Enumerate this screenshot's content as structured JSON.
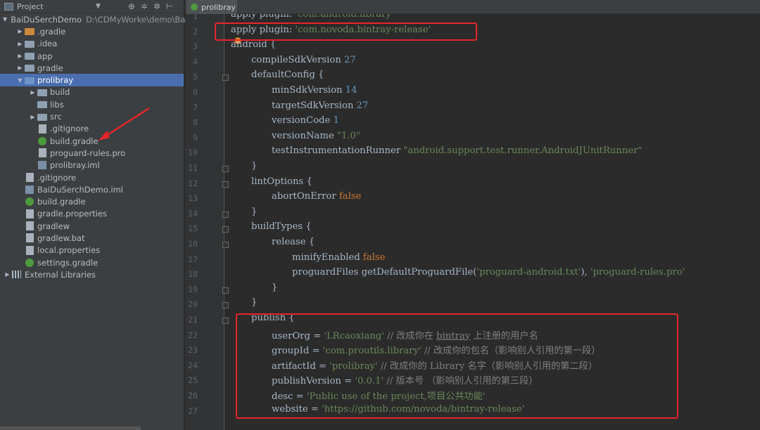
{
  "project_panel": {
    "title": "Project",
    "view_selector_icon": "chevron-down-icon",
    "tools": [
      "sync-icon",
      "collapse-icon",
      "gear-icon",
      "hide-icon"
    ],
    "tree": [
      {
        "label": "BaiDuSerchDemo",
        "path": "D:\\CDMyWorke\\demo\\Bai",
        "indent": 0,
        "arrow": "▼",
        "icon": "module",
        "selected": false
      },
      {
        "label": ".gradle",
        "indent": 1,
        "arrow": "▶",
        "icon": "folder-orange",
        "selected": false
      },
      {
        "label": ".idea",
        "indent": 1,
        "arrow": "▶",
        "icon": "folder",
        "selected": false
      },
      {
        "label": "app",
        "indent": 1,
        "arrow": "▶",
        "icon": "folder",
        "selected": false
      },
      {
        "label": "gradle",
        "indent": 1,
        "arrow": "▶",
        "icon": "folder",
        "selected": false
      },
      {
        "label": "prolibray",
        "indent": 1,
        "arrow": "▼",
        "icon": "folder-blue",
        "selected": true
      },
      {
        "label": "build",
        "indent": 2,
        "arrow": "▶",
        "icon": "folder",
        "selected": false
      },
      {
        "label": "libs",
        "indent": 2,
        "arrow": "",
        "icon": "folder",
        "selected": false
      },
      {
        "label": "src",
        "indent": 2,
        "arrow": "▶",
        "icon": "folder",
        "selected": false
      },
      {
        "label": ".gitignore",
        "indent": 2,
        "arrow": "",
        "icon": "file",
        "selected": false
      },
      {
        "label": "build.gradle",
        "indent": 2,
        "arrow": "",
        "icon": "gradle",
        "selected": false
      },
      {
        "label": "proguard-rules.pro",
        "indent": 2,
        "arrow": "",
        "icon": "file",
        "selected": false
      },
      {
        "label": "prolibray.iml",
        "indent": 2,
        "arrow": "",
        "icon": "iml",
        "selected": false
      },
      {
        "label": ".gitignore",
        "indent": 1,
        "arrow": "",
        "icon": "file",
        "selected": false
      },
      {
        "label": "BaiDuSerchDemo.iml",
        "indent": 1,
        "arrow": "",
        "icon": "iml",
        "selected": false
      },
      {
        "label": "build.gradle",
        "indent": 1,
        "arrow": "",
        "icon": "gradle",
        "selected": false
      },
      {
        "label": "gradle.properties",
        "indent": 1,
        "arrow": "",
        "icon": "file",
        "selected": false
      },
      {
        "label": "gradlew",
        "indent": 1,
        "arrow": "",
        "icon": "file",
        "selected": false
      },
      {
        "label": "gradlew.bat",
        "indent": 1,
        "arrow": "",
        "icon": "file",
        "selected": false
      },
      {
        "label": "local.properties",
        "indent": 1,
        "arrow": "",
        "icon": "file",
        "selected": false
      },
      {
        "label": "settings.gradle",
        "indent": 1,
        "arrow": "",
        "icon": "gradle",
        "selected": false
      },
      {
        "label": "External Libraries",
        "indent": 0,
        "arrow": "▶",
        "icon": "library",
        "selected": false
      }
    ]
  },
  "editor": {
    "tab_label": "prolibray",
    "tab_icon": "gradle-icon",
    "lines": [
      {
        "n": "1",
        "indent": 0,
        "tokens": [
          {
            "t": "apply plugin: ",
            "c": "plain"
          },
          {
            "t": "'com.android.library'",
            "c": "str"
          }
        ]
      },
      {
        "n": "2",
        "indent": 0,
        "tokens": [
          {
            "t": "apply plugin: ",
            "c": "plain"
          },
          {
            "t": "'com.novoda.bintray-release'",
            "c": "str"
          }
        ]
      },
      {
        "n": "3",
        "indent": 0,
        "tokens": [
          {
            "t": "android {",
            "c": "plain"
          }
        ]
      },
      {
        "n": "4",
        "indent": 1,
        "tokens": [
          {
            "t": "compileSdkVersion ",
            "c": "plain"
          },
          {
            "t": "27",
            "c": "num"
          }
        ]
      },
      {
        "n": "5",
        "indent": 1,
        "tokens": [
          {
            "t": "defaultConfig {",
            "c": "plain"
          }
        ]
      },
      {
        "n": "6",
        "indent": 2,
        "tokens": [
          {
            "t": "minSdkVersion ",
            "c": "plain"
          },
          {
            "t": "14",
            "c": "num"
          }
        ]
      },
      {
        "n": "7",
        "indent": 2,
        "tokens": [
          {
            "t": "targetSdkVersion ",
            "c": "plain"
          },
          {
            "t": "27",
            "c": "num"
          }
        ]
      },
      {
        "n": "8",
        "indent": 2,
        "tokens": [
          {
            "t": "versionCode ",
            "c": "plain"
          },
          {
            "t": "1",
            "c": "num"
          }
        ]
      },
      {
        "n": "9",
        "indent": 2,
        "tokens": [
          {
            "t": "versionName ",
            "c": "plain"
          },
          {
            "t": "\"1.0\"",
            "c": "str"
          }
        ]
      },
      {
        "n": "10",
        "indent": 2,
        "tokens": [
          {
            "t": "testInstrumentationRunner ",
            "c": "plain"
          },
          {
            "t": "\"android.support.test.runner.AndroidJUnitRunner\"",
            "c": "str"
          }
        ]
      },
      {
        "n": "11",
        "indent": 1,
        "tokens": [
          {
            "t": "}",
            "c": "plain"
          }
        ]
      },
      {
        "n": "12",
        "indent": 1,
        "tokens": [
          {
            "t": "lintOptions {",
            "c": "plain"
          }
        ]
      },
      {
        "n": "13",
        "indent": 2,
        "tokens": [
          {
            "t": "abortOnError ",
            "c": "plain"
          },
          {
            "t": "false",
            "c": "kw"
          }
        ]
      },
      {
        "n": "14",
        "indent": 1,
        "tokens": [
          {
            "t": "}",
            "c": "plain"
          }
        ]
      },
      {
        "n": "15",
        "indent": 1,
        "tokens": [
          {
            "t": "buildTypes {",
            "c": "plain"
          }
        ]
      },
      {
        "n": "16",
        "indent": 2,
        "tokens": [
          {
            "t": "release {",
            "c": "plain"
          }
        ]
      },
      {
        "n": "17",
        "indent": 3,
        "tokens": [
          {
            "t": "minifyEnabled ",
            "c": "plain"
          },
          {
            "t": "false",
            "c": "kw"
          }
        ]
      },
      {
        "n": "18",
        "indent": 3,
        "tokens": [
          {
            "t": "proguardFiles getDefaultProguardFile(",
            "c": "plain"
          },
          {
            "t": "'proguard-android.txt'",
            "c": "str"
          },
          {
            "t": "), ",
            "c": "plain"
          },
          {
            "t": "'proguard-rules.pro'",
            "c": "str"
          }
        ]
      },
      {
        "n": "19",
        "indent": 2,
        "tokens": [
          {
            "t": "}",
            "c": "plain"
          }
        ]
      },
      {
        "n": "20",
        "indent": 1,
        "tokens": [
          {
            "t": "}",
            "c": "plain"
          }
        ]
      },
      {
        "n": "21",
        "indent": 1,
        "tokens": [
          {
            "t": "publish {",
            "c": "plain"
          }
        ]
      },
      {
        "n": "22",
        "indent": 2,
        "tokens": [
          {
            "t": "userOrg = ",
            "c": "plain"
          },
          {
            "t": "'LRcaoxiang'",
            "c": "str"
          },
          {
            "t": " // 改成你在 ",
            "c": "cmt"
          },
          {
            "t": "bintray",
            "c": "link"
          },
          {
            "t": " 上注册的用户名",
            "c": "cmt"
          }
        ]
      },
      {
        "n": "23",
        "indent": 2,
        "tokens": [
          {
            "t": "groupId = ",
            "c": "plain"
          },
          {
            "t": "'com.proutils.library'",
            "c": "str"
          },
          {
            "t": " // 改成你的包名（影响别人引用的第一段）",
            "c": "cmt"
          }
        ]
      },
      {
        "n": "24",
        "indent": 2,
        "tokens": [
          {
            "t": "artifactId = ",
            "c": "plain"
          },
          {
            "t": "'prolibray'",
            "c": "str"
          },
          {
            "t": " // 改成你的 Library 名字（影响别人引用的第二段）",
            "c": "cmt"
          }
        ]
      },
      {
        "n": "25",
        "indent": 2,
        "tokens": [
          {
            "t": "publishVersion = ",
            "c": "plain"
          },
          {
            "t": "'0.0.1'",
            "c": "str"
          },
          {
            "t": " // 版本号 （影响别人引用的第三段）",
            "c": "cmt"
          }
        ]
      },
      {
        "n": "26",
        "indent": 2,
        "tokens": [
          {
            "t": "desc = ",
            "c": "plain"
          },
          {
            "t": "'Public use of the project,项目公共功能'",
            "c": "str"
          }
        ]
      },
      {
        "n": "27",
        "indent": 2,
        "tokens": [
          {
            "t": "website = ",
            "c": "plain"
          },
          {
            "t": "'https://github.com/novoda/bintray-release'",
            "c": "str"
          }
        ]
      }
    ]
  },
  "annotations": {
    "color": "#e8242b",
    "highlights": [
      "apply-plugin-line",
      "publish-block"
    ],
    "arrow_target": "build.gradle"
  }
}
